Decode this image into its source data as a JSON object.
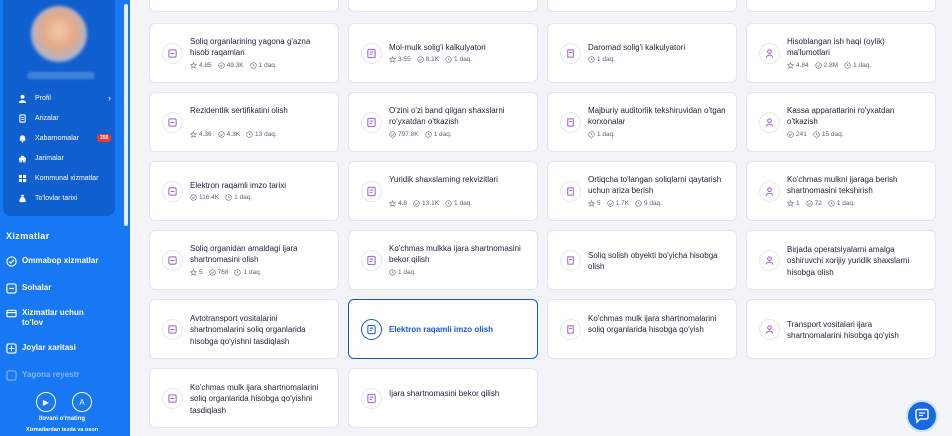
{
  "sidebar": {
    "menu": [
      {
        "label": "Profil",
        "icon": "user-icon"
      },
      {
        "label": "Arizalar",
        "icon": "document-icon"
      },
      {
        "label": "Xabarnomalar",
        "icon": "bell-icon",
        "badge": "358"
      },
      {
        "label": "Jarimalar",
        "icon": "car-icon"
      },
      {
        "label": "Kommunal xizmatlar",
        "icon": "grid-icon"
      },
      {
        "label": "To'lovlar tarixi",
        "icon": "wallet-icon"
      }
    ],
    "section_title": "Xizmatlar",
    "nav": [
      {
        "label": "Ommabop xizmatlar",
        "icon": "check-circle-icon"
      },
      {
        "label": "Sohalar",
        "icon": "layers-icon"
      },
      {
        "label": "Xizmatlar uchun to'lov",
        "icon": "card-icon"
      },
      {
        "label": "Joylar xaritasi",
        "icon": "map-icon"
      },
      {
        "label": "Yagona reyestr",
        "icon": "list-icon"
      }
    ],
    "app": {
      "title": "Ilovani o'rnating",
      "subtitle": "Xizmatlardan tezda va oson"
    }
  },
  "cards": [
    {
      "title": "Soliq organlarining yagona g'azna hisob raqamlari",
      "rating": "4.85",
      "views": "49.3K",
      "time": "1 daq."
    },
    {
      "title": "Mol-mulk solig'i kalkulyatori",
      "rating": "3.55",
      "views": "8.1K",
      "time": "1 daq."
    },
    {
      "title": "Daromad solig'i kalkulyatori",
      "time": "1 daq."
    },
    {
      "title": "Hisoblangan ish haqi (oylik) ma'lumotlari",
      "rating": "4.84",
      "views": "2.8M",
      "time": "1 daq."
    },
    {
      "title": "Rezidentlik sertifikatini olish",
      "rating": "4.36",
      "views": "4.3K",
      "time": "13 daq."
    },
    {
      "title": "O'zini o'zi band qilgan shaxslarni ro'yxatdan o'tkazish",
      "views": "797.8K",
      "time": "1 daq."
    },
    {
      "title": "Majburiy auditorlik tekshiruvidan o'tgan korxonalar",
      "time": "1 daq."
    },
    {
      "title": "Kassa apparatlarini ro'yxatdan o'tkazish",
      "views": "241",
      "time": "15 daq."
    },
    {
      "title": "Elektron raqamli imzo tarixi",
      "views": "116.4K",
      "time": "1 daq."
    },
    {
      "title": "Yuridik shaxslarning rekvizitlari",
      "rating": "4.8",
      "views": "13.1K",
      "time": "1 daq."
    },
    {
      "title": "Ortiqcha to'langan soliqlarni qaytarish uchun ariza berish",
      "rating": "5",
      "views": "1.7K",
      "time": "9 daq."
    },
    {
      "title": "Ko'chmas mulkni ijaraga berish shartnomasini tekshirish",
      "rating": "1",
      "views": "72",
      "time": "1 daq."
    },
    {
      "title": "Soliq organidan amaldagi ijara shartnomasini olish",
      "rating": "5",
      "views": "768",
      "time": "1 daq."
    },
    {
      "title": "Ko'chmas mulkka ijara shartnomasini bekor qilish",
      "time": "1 daq."
    },
    {
      "title": "Soliq solish obyekti bo'yicha hisobga olish"
    },
    {
      "title": "Birjada operatsiyalarni amalga oshiruvchi xorijiy yuridik shaxslarni hisobga olish"
    },
    {
      "title": "Avtotransport vositalarini shartnomalarini soliq organlarida hisobga qo'yishni tasdiqlash"
    },
    {
      "title": "Elektron raqamli imzo olish"
    },
    {
      "title": "Ko'chmas mulk ijara shartnomalarini soliq organlarida hisobga qo'yish"
    },
    {
      "title": "Transport vositalari ijara shartnomalarini hisobga qo'yish"
    },
    {
      "title": "Ko'chmas mulk ijara shartnomalarini soliq organlarida hisobga qo'yishni tasdiqlash"
    },
    {
      "title": "Ijara shartnomasini bekor qilish"
    }
  ],
  "colors": {
    "primary": "#1877f2",
    "selected": "#1a56c9",
    "icon_accent": "#9b5fd1"
  }
}
